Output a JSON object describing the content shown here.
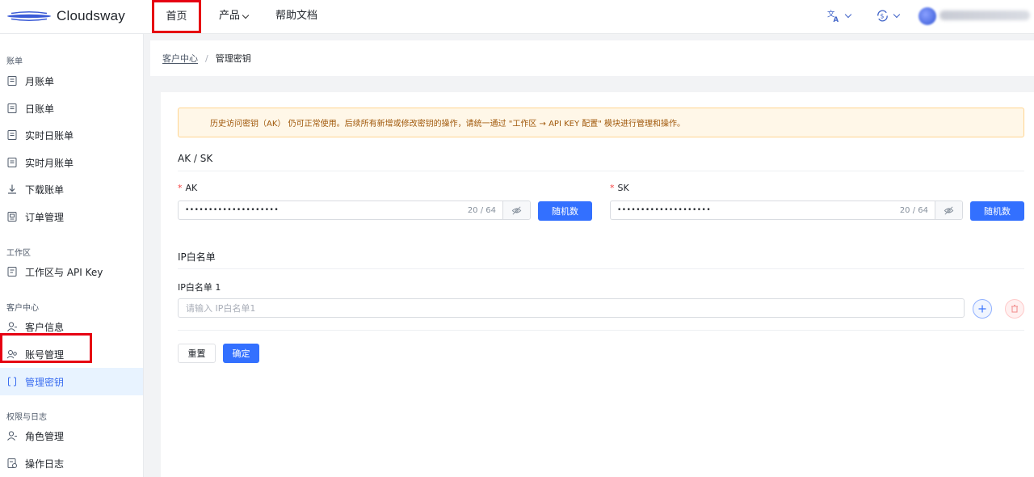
{
  "header": {
    "logo_text": "Cloudsway",
    "nav": {
      "home": "首页",
      "product": "产品",
      "docs": "帮助文档"
    },
    "icons": {
      "language": "translate-icon",
      "currency": "currency-exchange-icon"
    }
  },
  "sidebar": {
    "groups": [
      {
        "title": "账单"
      },
      {
        "title": "工作区"
      },
      {
        "title": "客户中心"
      },
      {
        "title": "权限与日志"
      }
    ],
    "items": [
      {
        "label": "月账单",
        "icon": "bill-icon"
      },
      {
        "label": "日账单",
        "icon": "bill-icon"
      },
      {
        "label": "实时日账单",
        "icon": "bill-icon"
      },
      {
        "label": "实时月账单",
        "icon": "bill-icon"
      },
      {
        "label": "下载账单",
        "icon": "download-icon"
      },
      {
        "label": "订单管理",
        "icon": "order-icon"
      },
      {
        "label": "工作区与 API Key",
        "icon": "workspace-icon"
      },
      {
        "label": "客户信息",
        "icon": "user-icon"
      },
      {
        "label": "账号管理",
        "icon": "account-icon"
      },
      {
        "label": "管理密钥",
        "icon": "key-icon",
        "active": true
      },
      {
        "label": "角色管理",
        "icon": "user-icon"
      },
      {
        "label": "操作日志",
        "icon": "log-icon"
      }
    ]
  },
  "breadcrumb": {
    "parent": "客户中心",
    "separator": "/",
    "current": "管理密钥"
  },
  "alert": {
    "text": "历史访问密钥（AK） 仍可正常使用。后续所有新增或修改密钥的操作，请统一通过 \"工作区 → API KEY 配置\" 模块进行管理和操作。"
  },
  "aksk": {
    "title": "AK / SK",
    "required_mark": "*",
    "ak": {
      "label": "AK",
      "value_masked": "••••••••••••••••••••",
      "count": "20 / 64",
      "random_button": "随机数"
    },
    "sk": {
      "label": "SK",
      "value_masked": "••••••••••••••••••••",
      "count": "20 / 64",
      "random_button": "随机数"
    }
  },
  "ip_whitelist": {
    "title": "IP白名单",
    "field_label": "IP白名单 1",
    "placeholder": "请输入 IP白名单1",
    "value": ""
  },
  "actions": {
    "reset": "重置",
    "confirm": "确定"
  },
  "colors": {
    "primary": "#3370ff",
    "highlight_box": "#e60012",
    "alert_bg": "#fff7e8",
    "alert_text": "#a0580a"
  }
}
